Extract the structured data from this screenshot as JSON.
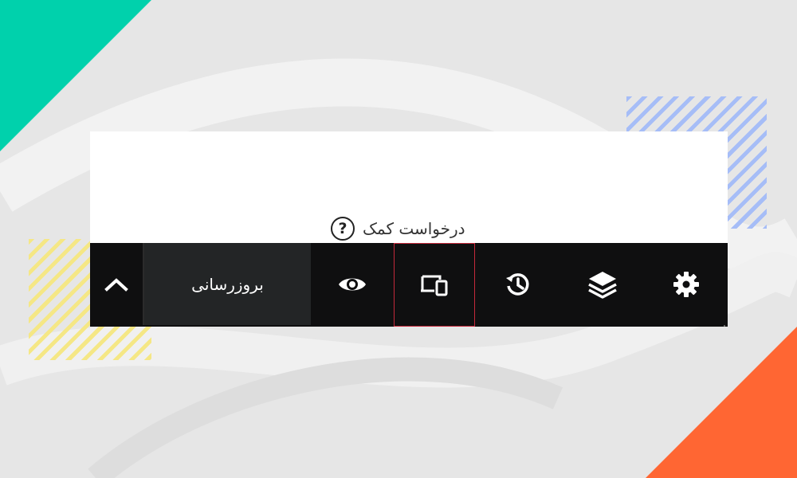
{
  "help": {
    "label": "درخواست کمک",
    "icon": "question-circle-icon"
  },
  "toolbar": {
    "update_label": "بروزرسانی",
    "items": [
      {
        "name": "collapse",
        "icon": "chevron-up-icon"
      },
      {
        "name": "preview",
        "icon": "eye-icon"
      },
      {
        "name": "responsive-mode",
        "icon": "devices-icon",
        "highlighted": true
      },
      {
        "name": "history",
        "icon": "history-icon"
      },
      {
        "name": "navigator",
        "icon": "layers-icon"
      },
      {
        "name": "settings",
        "icon": "gear-icon"
      }
    ]
  },
  "colors": {
    "toolbar_bg": "#0f0f10",
    "update_bg": "#232526",
    "highlight_border": "#c4293b",
    "accent_teal": "#00d1ac",
    "accent_orange": "#ff6633"
  }
}
